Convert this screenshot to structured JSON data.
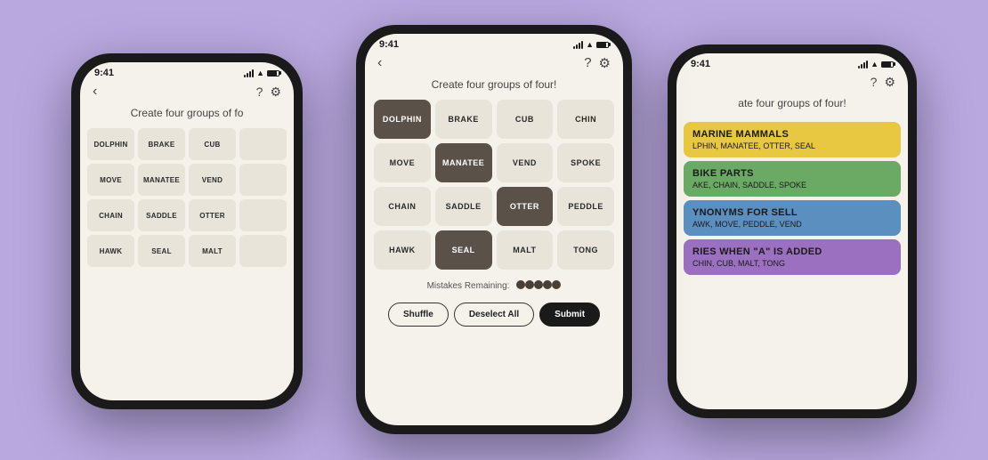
{
  "background_color": "#b9a8e0",
  "instruction": "Create four groups of four!",
  "status_time": "9:41",
  "phone_left": {
    "status_time": "9:41",
    "instruction": "Create four groups of fo",
    "grid": [
      "DOLPHIN",
      "BRAKE",
      "CUB",
      "",
      "MOVE",
      "MANATEE",
      "VEND",
      "",
      "CHAIN",
      "SADDLE",
      "OTTER",
      "",
      "HAWK",
      "SEAL",
      "MALT",
      ""
    ]
  },
  "phone_center": {
    "status_time": "9:41",
    "instruction": "Create four groups of four!",
    "grid": [
      {
        "word": "DOLPHIN",
        "selected": true
      },
      {
        "word": "BRAKE",
        "selected": false
      },
      {
        "word": "CUB",
        "selected": false
      },
      {
        "word": "CHIN",
        "selected": false
      },
      {
        "word": "MOVE",
        "selected": false
      },
      {
        "word": "MANATEE",
        "selected": true
      },
      {
        "word": "VEND",
        "selected": false
      },
      {
        "word": "SPOKE",
        "selected": false
      },
      {
        "word": "CHAIN",
        "selected": false
      },
      {
        "word": "SADDLE",
        "selected": false
      },
      {
        "word": "OTTER",
        "selected": true
      },
      {
        "word": "PEDDLE",
        "selected": false
      },
      {
        "word": "HAWK",
        "selected": false
      },
      {
        "word": "SEAL",
        "selected": true
      },
      {
        "word": "MALT",
        "selected": false
      },
      {
        "word": "TONG",
        "selected": false
      }
    ],
    "mistakes_label": "Mistakes Remaining:",
    "dots": [
      {
        "color": "#4a3f35"
      },
      {
        "color": "#4a3f35"
      },
      {
        "color": "#4a3f35"
      },
      {
        "color": "#4a3f35"
      },
      {
        "color": "#4a3f35"
      }
    ],
    "btn_shuffle": "Shuffle",
    "btn_deselect": "Deselect All",
    "btn_submit": "Submit"
  },
  "phone_right": {
    "status_time": "9:41",
    "instruction": "ate four groups of four!",
    "cards": [
      {
        "color": "yellow",
        "title": "MARINE MAMMALS",
        "words": "LPHIN, MANATEE, OTTER, SEAL"
      },
      {
        "color": "green",
        "title": "BIKE PARTS",
        "words": "AKE, CHAIN, SADDLE, SPOKE"
      },
      {
        "color": "blue",
        "title": "YNONYMS FOR SELL",
        "words": "AWK, MOVE, PEDDLE, VEND"
      },
      {
        "color": "purple",
        "title": "RIES WHEN \"A\" IS ADDED",
        "words": "CHIN, CUB, MALT, TONG"
      }
    ]
  }
}
